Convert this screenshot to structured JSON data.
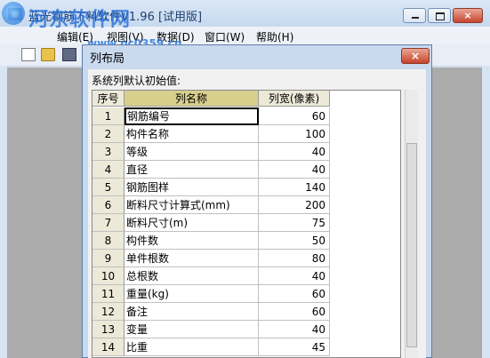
{
  "window": {
    "title": "蓝光钢筋下料软件V1.96 [试用版]",
    "watermark": "河东软件网",
    "watermark_url": "www.pc0359.cn"
  },
  "menu": [
    "编辑(E)",
    "视图(V)",
    "数据(D)",
    "窗口(W)",
    "帮助(H)"
  ],
  "dialog": {
    "title": "列布局",
    "caption": "系统列默认初始值:",
    "close_glyph": "×",
    "headers": {
      "index": "序号",
      "name": "列名称",
      "width": "列宽(像素)"
    },
    "rows": [
      {
        "index": "1",
        "name": "钢筋编号",
        "width": "60"
      },
      {
        "index": "2",
        "name": "构件名称",
        "width": "100"
      },
      {
        "index": "3",
        "name": "等级",
        "width": "40"
      },
      {
        "index": "4",
        "name": "直径",
        "width": "40"
      },
      {
        "index": "5",
        "name": "钢筋图样",
        "width": "140"
      },
      {
        "index": "6",
        "name": "断料尺寸计算式(mm)",
        "width": "200"
      },
      {
        "index": "7",
        "name": "断料尺寸(m)",
        "width": "75"
      },
      {
        "index": "8",
        "name": "构件数",
        "width": "50"
      },
      {
        "index": "9",
        "name": "单件根数",
        "width": "80"
      },
      {
        "index": "10",
        "name": "总根数",
        "width": "40"
      },
      {
        "index": "11",
        "name": "重量(kg)",
        "width": "60"
      },
      {
        "index": "12",
        "name": "备注",
        "width": "60"
      },
      {
        "index": "13",
        "name": "变量",
        "width": "40"
      },
      {
        "index": "14",
        "name": "比重",
        "width": "45"
      }
    ]
  },
  "icons": {
    "app": "app-icon",
    "minimize": "minimize-icon",
    "maximize": "maximize-icon",
    "close": "close-icon",
    "new": "new-file-icon",
    "open": "open-folder-icon",
    "save": "save-icon"
  }
}
